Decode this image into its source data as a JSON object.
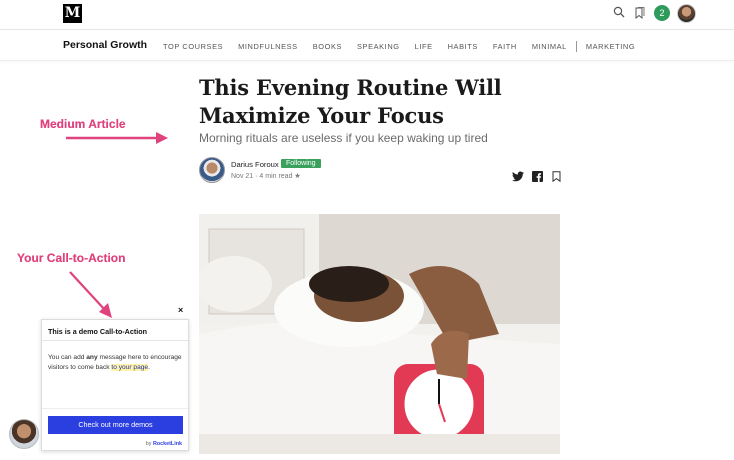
{
  "topbar": {
    "logo": "M",
    "notification_count": "2"
  },
  "pubnav": {
    "publication": "Personal Growth",
    "items": [
      "TOP COURSES",
      "MINDFULNESS",
      "BOOKS",
      "SPEAKING",
      "LIFE",
      "HABITS",
      "FAITH",
      "MINIMAL",
      "MARKETING"
    ]
  },
  "article": {
    "title": "This Evening Routine Will Maximize Your Focus",
    "subtitle": "Morning rituals are useless if you keep waking up tired",
    "author": "Darius Foroux",
    "follow_status": "Following",
    "meta": "Nov 21 · 4 min read ★"
  },
  "annotations": {
    "medium": "Medium Article",
    "cta": "Your Call-to-Action"
  },
  "cta": {
    "title": "This is a demo Call-to-Action",
    "body_part1": "You can add ",
    "body_bold": "any",
    "body_part2": " message here to encourage visitors to come back ",
    "body_highlight": "to your page",
    "body_end": ".",
    "button": "Check out more demos",
    "powered_prefix": "by ",
    "powered_brand": "RocketLink",
    "close": "×"
  },
  "colors": {
    "accent_pink": "#e0427d",
    "cta_blue": "#2b3fe0",
    "follow_green": "#39a15c"
  }
}
